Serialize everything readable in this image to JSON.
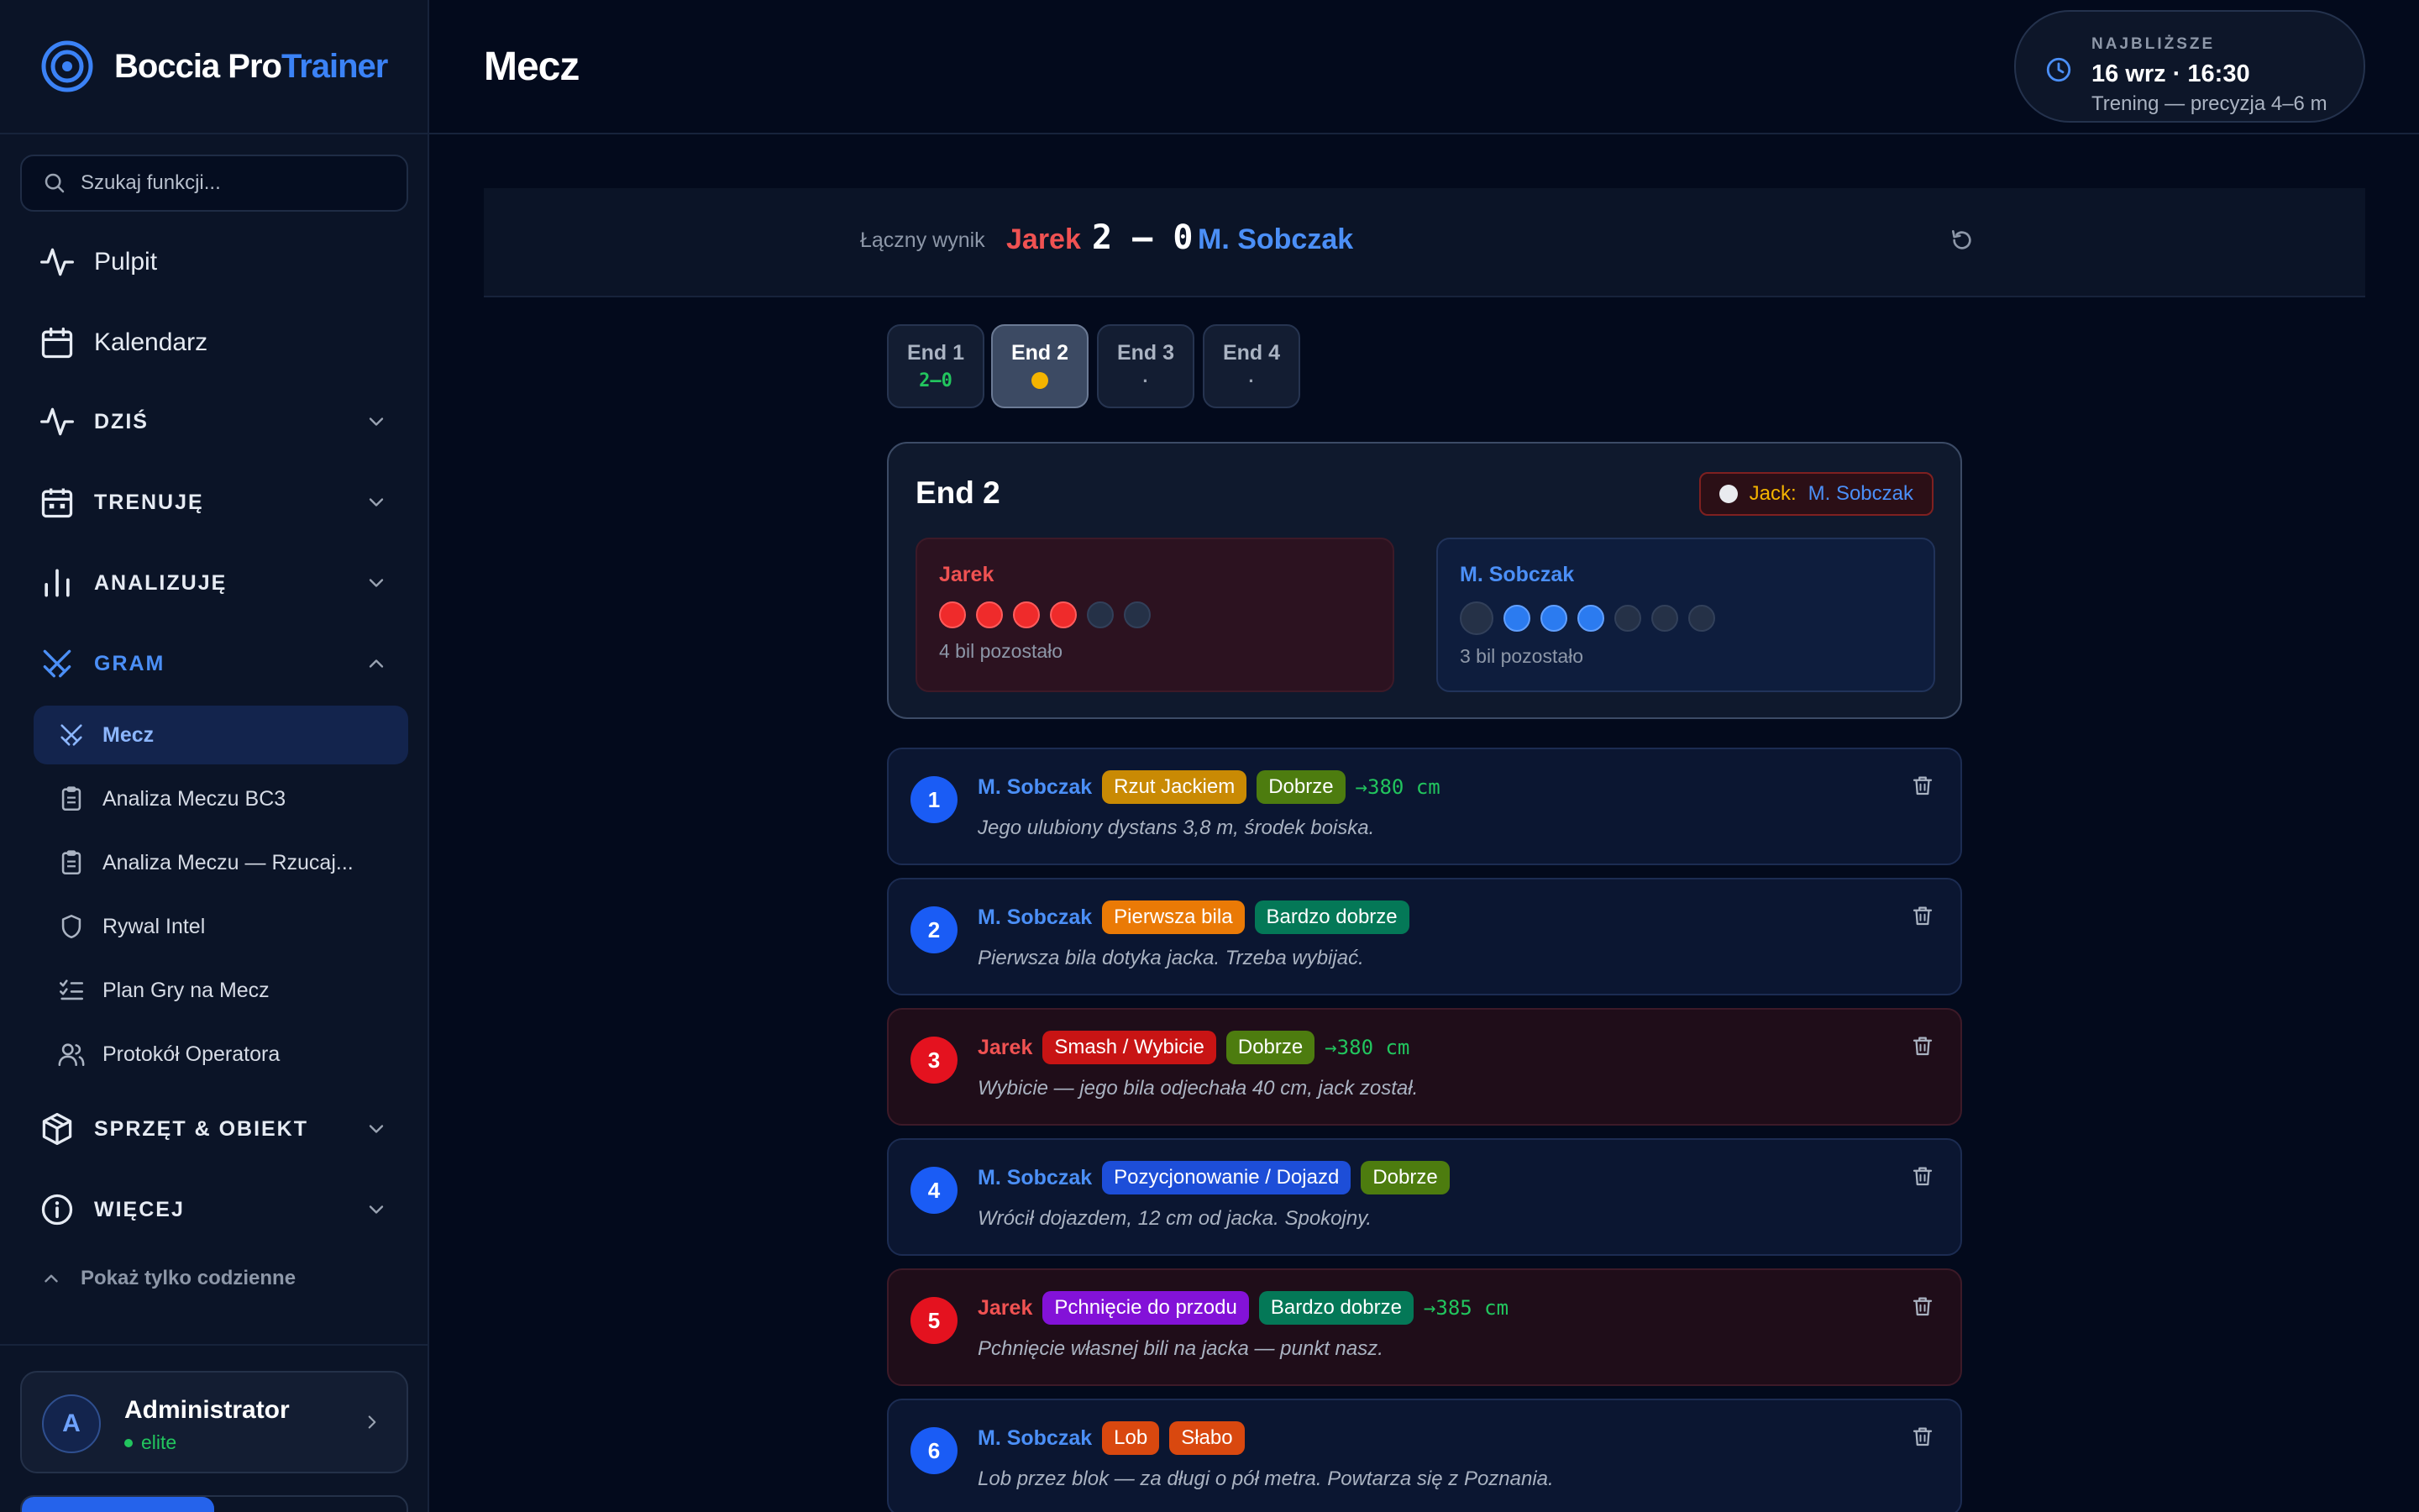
{
  "brand": {
    "name_part1": "Boccia Pro",
    "name_part2": "Trainer"
  },
  "search": {
    "placeholder": "Szukaj funkcji..."
  },
  "nav": {
    "pulpit": "Pulpit",
    "kalendarz": "Kalendarz",
    "groups": {
      "dzis": "DZIŚ",
      "trenuje": "TRENUJĘ",
      "analizuje": "ANALIZUJĘ",
      "gram": "GRAM",
      "sprzet": "SPRZĘT & OBIEKT",
      "wiecej": "WIĘCEJ"
    },
    "gram_items": [
      {
        "label": "Mecz",
        "icon": "crossed-swords-icon"
      },
      {
        "label": "Analiza Meczu BC3",
        "icon": "clipboard-icon"
      },
      {
        "label": "Analiza Meczu — Rzucaj...",
        "icon": "clipboard-icon"
      },
      {
        "label": "Rywal Intel",
        "icon": "shield-icon"
      },
      {
        "label": "Plan Gry na Mecz",
        "icon": "checklist-icon"
      },
      {
        "label": "Protokół Operatora",
        "icon": "users-icon"
      }
    ],
    "daily_toggle": "Pokaż tylko codzienne"
  },
  "user": {
    "initial": "A",
    "name": "Administrator",
    "role": "elite",
    "progress": 0.5
  },
  "header": {
    "title": "Mecz",
    "next": {
      "label": "NAJBLIŻSZE",
      "date": "16 wrz · 16:30",
      "description": "Trening — precyzja 4–6 m"
    }
  },
  "score": {
    "label": "Łączny wynik",
    "player1": "Jarek",
    "score_text": "2 – 0",
    "player2": "M. Sobczak"
  },
  "ends": [
    {
      "label": "End 1",
      "status": "2–0"
    },
    {
      "label": "End 2",
      "status": ""
    },
    {
      "label": "End 3",
      "status": "·"
    },
    {
      "label": "End 4",
      "status": "·"
    }
  ],
  "current_end": {
    "title": "End 2",
    "jack_label": "Jack:",
    "jack_owner": "M. Sobczak",
    "red": {
      "name": "Jarek",
      "remaining_text": "4 bil pozostało"
    },
    "blue": {
      "name": "M. Sobczak",
      "remaining_text": "3 bil pozostało"
    }
  },
  "throws": [
    {
      "n": "1",
      "side": "blue",
      "player": "M. Sobczak",
      "type": "Rzut Jackiem",
      "type_color": "amber",
      "grade": "Dobrze",
      "grade_color": "olive",
      "distance": "→380 cm",
      "note": "Jego ulubiony dystans 3,8 m, środek boiska."
    },
    {
      "n": "2",
      "side": "blue",
      "player": "M. Sobczak",
      "type": "Pierwsza bila",
      "type_color": "orange",
      "grade": "Bardzo dobrze",
      "grade_color": "green",
      "distance": "",
      "note": "Pierwsza bila dotyka jacka. Trzeba wybijać."
    },
    {
      "n": "3",
      "side": "red",
      "player": "Jarek",
      "type": "Smash / Wybicie",
      "type_color": "red",
      "grade": "Dobrze",
      "grade_color": "olive",
      "distance": "→380 cm",
      "note": "Wybicie — jego bila odjechała 40 cm, jack został."
    },
    {
      "n": "4",
      "side": "blue",
      "player": "M. Sobczak",
      "type": "Pozycjonowanie / Dojazd",
      "type_color": "blue",
      "grade": "Dobrze",
      "grade_color": "olive",
      "distance": "",
      "note": "Wrócił dojazdem, 12 cm od jacka. Spokojny."
    },
    {
      "n": "5",
      "side": "red",
      "player": "Jarek",
      "type": "Pchnięcie do przodu",
      "type_color": "purple",
      "grade": "Bardzo dobrze",
      "grade_color": "green",
      "distance": "→385 cm",
      "note": "Pchnięcie własnej bili na jacka — punkt nasz."
    },
    {
      "n": "6",
      "side": "blue",
      "player": "M. Sobczak",
      "type": "Lob",
      "type_color": "orangered",
      "grade": "Słabo",
      "grade_color": "orangered",
      "distance": "",
      "note": "Lob przez blok — za długi o pół metra. Powtarza się z Poznania."
    }
  ]
}
